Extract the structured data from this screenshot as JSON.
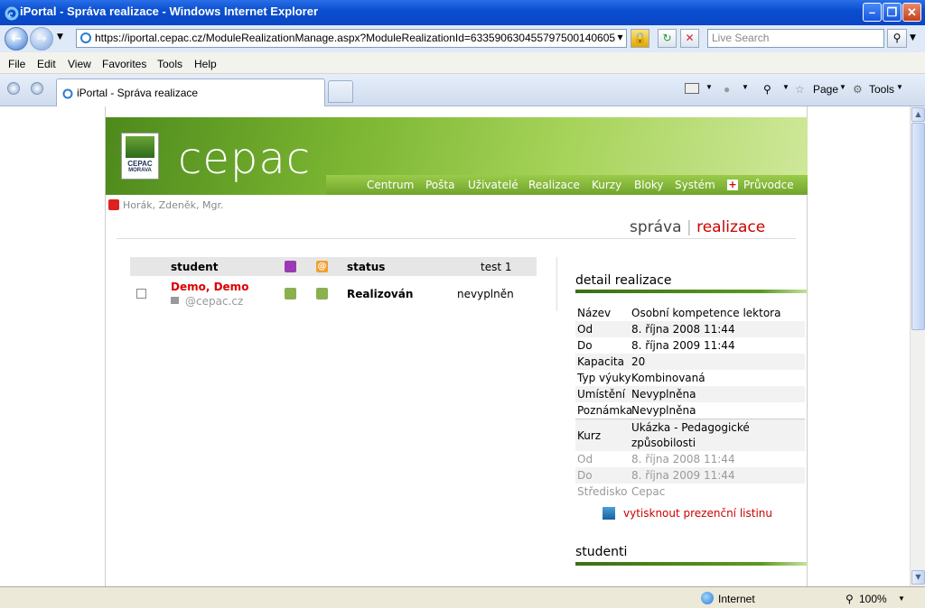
{
  "window": {
    "title": "iPortal - Správa realizace - Windows Internet Explorer"
  },
  "address": {
    "url": "https://iportal.cepac.cz/ModuleRealizationManage.aspx?ModuleRealizationId=633590630455797500140605",
    "search_placeholder": "Live Search"
  },
  "menu": {
    "file": "File",
    "edit": "Edit",
    "view": "View",
    "favorites": "Favorites",
    "tools": "Tools",
    "help": "Help"
  },
  "tab": {
    "label": "iPortal - Správa realizace"
  },
  "commandbar": {
    "page": "Page",
    "tools": "Tools"
  },
  "site": {
    "brand": "cepac",
    "logo_text": "CEPAC",
    "logo_sub": "MORAVA",
    "nav": [
      "Centrum",
      "Pošta",
      "Uživatelé",
      "Realizace",
      "Kurzy",
      "Bloky",
      "Systém",
      "Průvodce"
    ],
    "user": "Horák, Zdeněk, Mgr.",
    "title_a": "správa",
    "title_sep": "|",
    "title_b": "realizace"
  },
  "students": {
    "headers": {
      "student": "student",
      "status": "status",
      "test": "test 1"
    },
    "rows": [
      {
        "name": "Demo, Demo",
        "email": "@cepac.cz",
        "status": "Realizován",
        "test": "nevyplněn"
      }
    ]
  },
  "detail": {
    "title": "detail realizace",
    "rows": [
      {
        "k": "Název",
        "v": "Osobní kompetence lektora"
      },
      {
        "k": "Od",
        "v": "8. října 2008 11:44"
      },
      {
        "k": "Do",
        "v": "8. října 2009 11:44"
      },
      {
        "k": "Kapacita",
        "v": "20"
      },
      {
        "k": "Typ výuky",
        "v": "Kombinovaná"
      },
      {
        "k": "Umístění",
        "v": "Nevyplněna"
      },
      {
        "k": "Poznámka",
        "v": "Nevyplněna"
      }
    ],
    "course": {
      "k": "Kurz",
      "v1": "Ukázka - Pedagogické",
      "v2": "způsobilosti"
    },
    "gray_rows": [
      {
        "k": "Od",
        "v": "8. října 2008 11:44"
      },
      {
        "k": "Do",
        "v": "8. října 2009 11:44"
      },
      {
        "k": "Středisko",
        "v": "Cepac"
      }
    ],
    "print_link": "vytisknout prezenční listinu"
  },
  "students_section": {
    "title": "studenti"
  },
  "status": {
    "zone": "Internet",
    "zoom": "100%"
  }
}
